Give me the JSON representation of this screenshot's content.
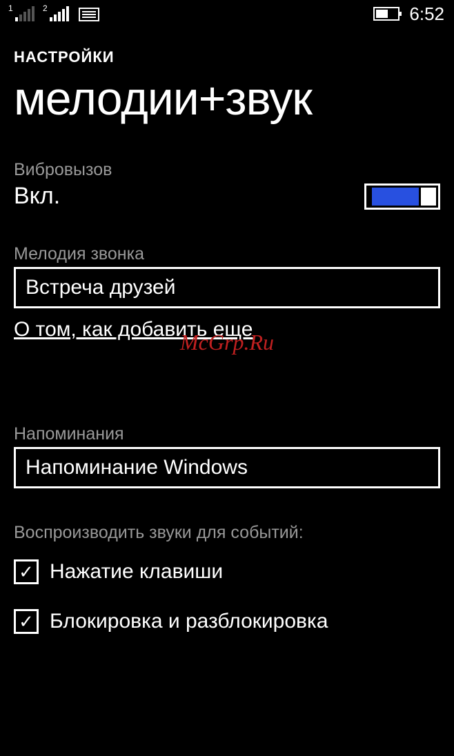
{
  "statusBar": {
    "sim1": "1",
    "sim2": "2",
    "time": "6:52"
  },
  "breadcrumb": "НАСТРОЙКИ",
  "pageTitle": "мелодии+звук",
  "vibrate": {
    "label": "Вибровызов",
    "value": "Вкл."
  },
  "ringtone": {
    "label": "Мелодия звонка",
    "value": "Встреча друзей"
  },
  "addMoreLink": "О том, как добавить еще",
  "reminders": {
    "label": "Напоминания",
    "value": "Напоминание Windows"
  },
  "eventsLabel": "Воспроизводить звуки для событий:",
  "checkboxes": {
    "keypress": "Нажатие клавиши",
    "lock": "Блокировка и разблокировка"
  },
  "watermark": "McGrp.Ru"
}
